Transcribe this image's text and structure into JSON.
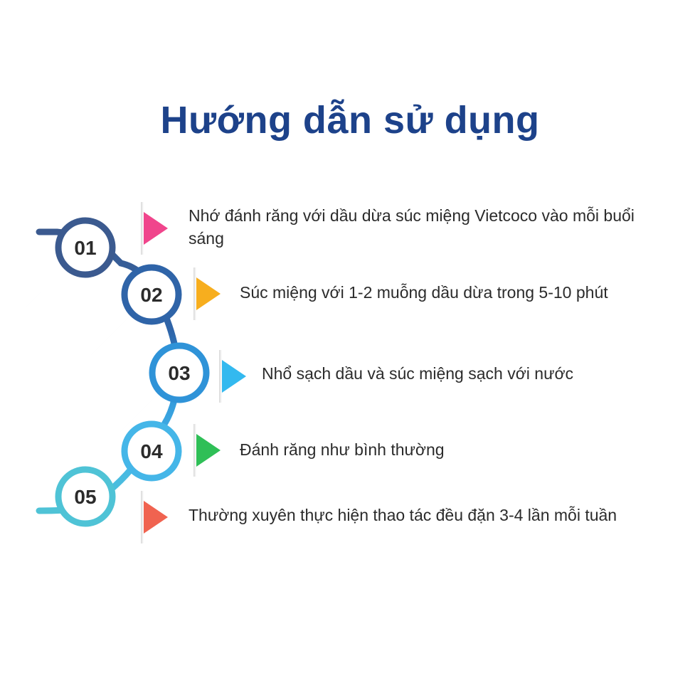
{
  "title": "Hướng dẫn sử dụng",
  "steps": [
    {
      "number": "01",
      "text": "Nhớ đánh răng với dầu dừa súc miệng Vietcoco vào mỗi buổi sáng",
      "ring_color": "#3b5a8f",
      "arrow_color": "#f0458c"
    },
    {
      "number": "02",
      "text": "Súc miệng với 1-2 muỗng dầu dừa trong 5-10 phút",
      "ring_color": "#2f64a8",
      "arrow_color": "#f7ae1e"
    },
    {
      "number": "03",
      "text": "Nhổ sạch dầu và súc miệng sạch với nước",
      "ring_color": "#2f93d8",
      "arrow_color": "#33b9ef"
    },
    {
      "number": "04",
      "text": "Đánh răng như bình thường",
      "ring_color": "#45b6e8",
      "arrow_color": "#2fbf57"
    },
    {
      "number": "05",
      "text": "Thường xuyên thực hiện thao tác đều đặn 3-4 lần mỗi tuần",
      "ring_color": "#4fc3d6",
      "arrow_color": "#f06350"
    }
  ]
}
